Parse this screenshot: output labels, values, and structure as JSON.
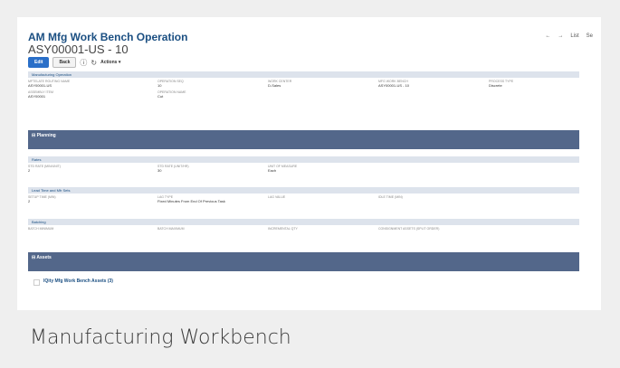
{
  "header": {
    "title": "AM Mfg Work Bench Operation",
    "record": "ASY00001-US - 10"
  },
  "nav": [
    "←",
    "→",
    "List",
    "Se"
  ],
  "toolbar": {
    "edit": "Edit",
    "back": "Back",
    "actions": "Actions ▾"
  },
  "bars": {
    "manufacturing_operation": "Manufacturing Operation",
    "rates": "Rates",
    "lead_time": "Lead Time and Mfr Sets",
    "batching": "Batching"
  },
  "sections": {
    "planning": "⊟ Planning",
    "assets": "⊟ Assets"
  },
  "fields": {
    "routing_name": {
      "label": "MFTELATE ROUTING NAME",
      "value": "ASY00001-US"
    },
    "operation_seq": {
      "label": "OPERATION SEQ",
      "value": "10"
    },
    "work_center": {
      "label": "WORK CENTER",
      "value": "D-Sales"
    },
    "mfg_work_bench": {
      "label": "MFG WORK BENCH",
      "value": "ASY00001-US - 10"
    },
    "process_type": {
      "label": "PROCESS TYPE",
      "value": "Discrete"
    },
    "assembly_item": {
      "label": "ASSEMBLY ITEM",
      "value": "ASY00001"
    },
    "operation_name": {
      "label": "OPERATION NAME",
      "value": "Cut"
    },
    "std_rate_min": {
      "label": "STD RATE (MIN/UNIT)",
      "value": "2"
    },
    "std_rate_unit": {
      "label": "STD RATE (UNIT/HR)",
      "value": "30"
    },
    "uom": {
      "label": "UNIT OF MEASURE",
      "value": "Each"
    },
    "setup_time": {
      "label": "SETUP TIME (MIN)",
      "value": "2"
    },
    "lag_type": {
      "label": "LAG TYPE",
      "value": "Fixed Minutes From End Of Previous Task"
    },
    "lag_value": {
      "label": "LAG VALUE",
      "value": ""
    },
    "idle_time": {
      "label": "IDLE TIME (MIN)",
      "value": ""
    },
    "batch_min": {
      "label": "BATCH MINIMUM",
      "value": ""
    },
    "batch_max": {
      "label": "BATCH MAXIMUM",
      "value": ""
    },
    "incremental_qty": {
      "label": "INCREMENTAL QTY",
      "value": ""
    },
    "consignment": {
      "label": "CONSIGNMENT ASSETS (SPLIT ORDER)",
      "value": ""
    }
  },
  "sublist": "IQity Mfg Work Bench Assets (3)",
  "caption": "Manufacturing Workbench"
}
